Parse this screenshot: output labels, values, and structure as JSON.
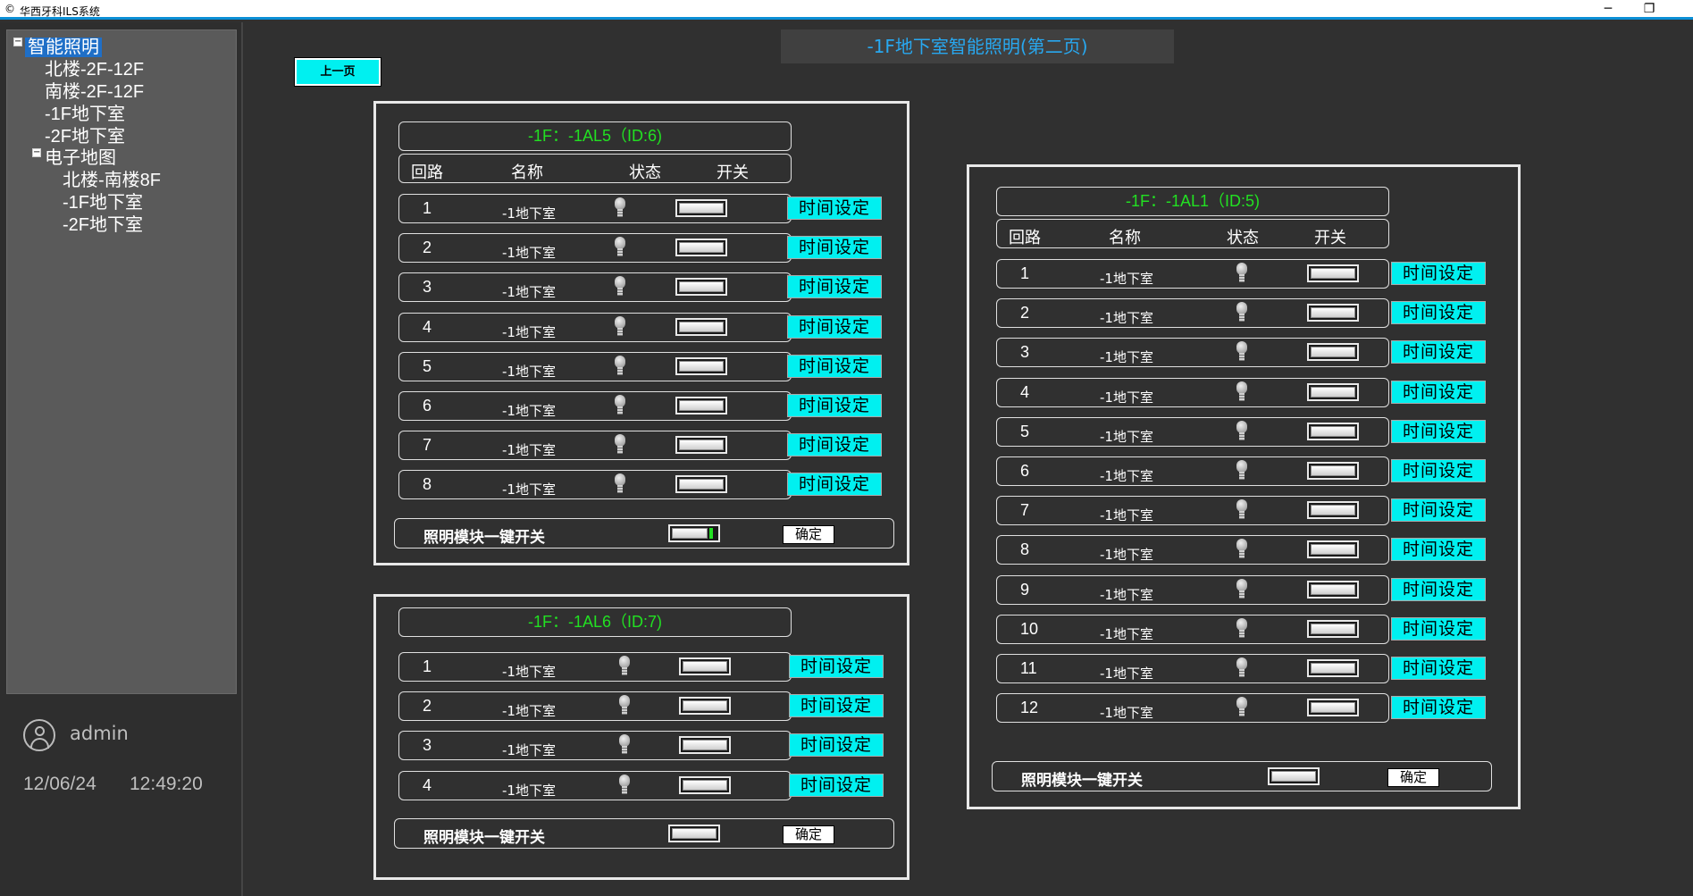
{
  "window": {
    "title": "华西牙科ILS系统",
    "minimize_glyph": "─",
    "maximize_glyph": "❐"
  },
  "sidebar": {
    "tree": [
      {
        "label": "智能照明",
        "selected": true
      },
      {
        "label": "北楼-2F-12F"
      },
      {
        "label": "南楼-2F-12F"
      },
      {
        "label": "-1F地下室"
      },
      {
        "label": "-2F地下室"
      },
      {
        "label": "电子地图"
      },
      {
        "label": "北楼-南楼8F"
      },
      {
        "label": "-1F地下室"
      },
      {
        "label": "-2F地下室"
      }
    ],
    "toggle_minus": "−",
    "username": "admin",
    "date": "12/06/24",
    "time": "12:49:20"
  },
  "main": {
    "page_title": "-1F地下室智能照明(第二页)",
    "prev_button": "上一页"
  },
  "labels": {
    "col_circuit": "回路",
    "col_name": "名称",
    "col_status": "状态",
    "col_switch": "开关",
    "time_setting": "时间设定",
    "master_switch": "照明模块一键开关",
    "confirm": "确定",
    "room_name": "-1地下室"
  },
  "panels": [
    {
      "title": "-1F：-1AL5（ID:6)",
      "has_header": true,
      "rows": [
        "1",
        "2",
        "3",
        "4",
        "5",
        "6",
        "7",
        "8"
      ],
      "master_on": true
    },
    {
      "title": "-1F：-1AL6（ID:7)",
      "has_header": false,
      "rows": [
        "1",
        "2",
        "3",
        "4"
      ],
      "master_on": false
    },
    {
      "title": "-1F：-1AL1（ID:5)",
      "has_header": true,
      "rows": [
        "1",
        "2",
        "3",
        "4",
        "5",
        "6",
        "7",
        "8",
        "9",
        "10",
        "11",
        "12"
      ],
      "master_on": false
    }
  ],
  "colors": {
    "accent_cyan": "#00f0f0",
    "title_blue": "#28a8f0",
    "panel_title_green": "#22e022",
    "selected_blue": "#1f6fc7"
  }
}
